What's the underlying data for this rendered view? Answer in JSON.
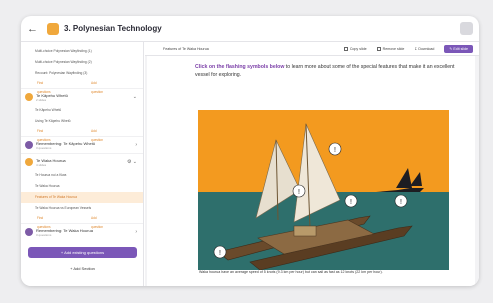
{
  "topbar": {
    "course_title": "3. Polynesian Technology"
  },
  "sidebar": {
    "items_top": [
      {
        "label": "Multi-choice Polynesian Wayfinding (1)"
      },
      {
        "label": "Multi-choice Polynesian Wayfinding (2)"
      },
      {
        "label": "Recount: Polynesian Wayfinding (3)"
      }
    ],
    "actions": {
      "find": "Find questions",
      "add": "Add question"
    },
    "section_1": {
      "title": "Te Kāpehu Whetū",
      "meta": "2 slides"
    },
    "section_1_items": [
      {
        "label": "Te Kāpehu Whetū"
      },
      {
        "label": "Using Te Kāpehu Whetū"
      }
    ],
    "section_2": {
      "title": "Remembering: Te Kāpehu Whetū",
      "meta": "3 questions"
    },
    "section_3": {
      "title": "Te Waka Hourua",
      "meta": "4 slides"
    },
    "section_3_items": [
      {
        "label": "Te Hourua nui a Kiwa"
      },
      {
        "label": "Te Waka Hourua"
      },
      {
        "label": "Features of Te Waka Hourua"
      },
      {
        "label": "Te Waka Hourua vs European Vessels"
      }
    ],
    "section_4": {
      "title": "Remembering: Te Waka Hourua",
      "meta": "3 questions"
    },
    "add_existing": "Add existing questions",
    "add_section": "Add Section"
  },
  "main": {
    "slide_title": "Features of Te Waka Hourua",
    "copy_slide": "Copy slide",
    "remove_slide": "Remove slide",
    "download": "Download",
    "edit_slide": "Edit slide"
  },
  "slide": {
    "intro_bold": "Click on the flashing symbols below",
    "intro_rest": " to learn more about some of the special features that make it an excellent vessel for exploring.",
    "caption": "Waka hourua have an average speed of 5 knots (9.3 km per hour) but can sail as fast as 12 knots (22 km per hour)."
  },
  "colors": {
    "accent": "#7b57b8",
    "orange": "#f0a83c",
    "sky": "#f39a1f",
    "sea": "#2e6f6c"
  }
}
